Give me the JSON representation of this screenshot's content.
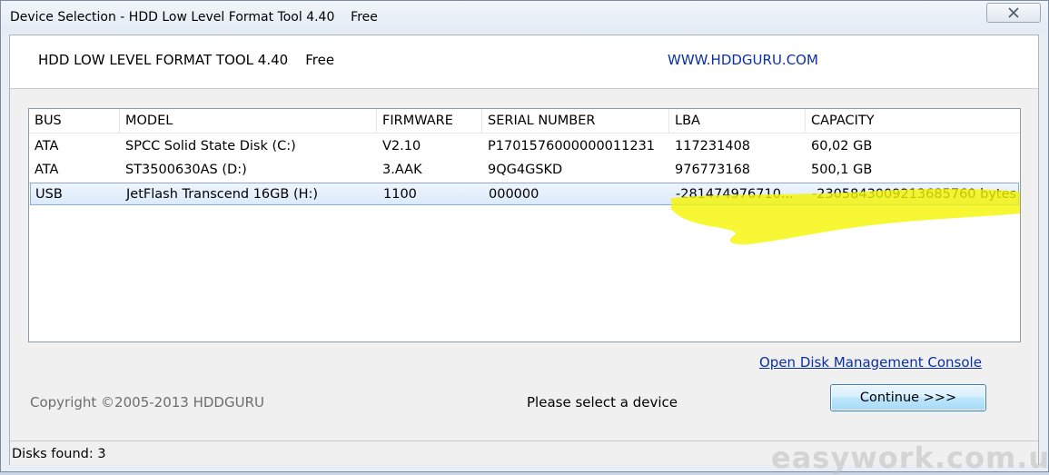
{
  "window": {
    "title": "Device Selection - HDD Low Level Format Tool 4.40    Free"
  },
  "header": {
    "product": "HDD LOW LEVEL FORMAT TOOL 4.40    Free",
    "website": "WWW.HDDGURU.COM"
  },
  "device_list": {
    "columns": [
      "BUS",
      "MODEL",
      "FIRMWARE",
      "SERIAL NUMBER",
      "LBA",
      "CAPACITY"
    ],
    "rows": [
      {
        "bus": "ATA",
        "model": "SPCC Solid State Disk (C:)",
        "firmware": "V2.10",
        "serial": "P1701576000000011231",
        "lba": "117231408",
        "capacity": "60,02 GB"
      },
      {
        "bus": "ATA",
        "model": "ST3500630AS (D:)",
        "firmware": "3.AAK",
        "serial": "9QG4GSKD",
        "lba": "976773168",
        "capacity": "500,1 GB"
      },
      {
        "bus": "USB",
        "model": "JetFlash Transcend 16GB (H:)",
        "firmware": "1100",
        "serial": "000000",
        "lba": "-281474976710...",
        "capacity": "-2305843009213685760 bytes"
      }
    ],
    "selected_index": 2
  },
  "actions": {
    "disk_management_link": "Open Disk Management Console",
    "continue_label": "Continue >>>"
  },
  "footer": {
    "copyright": "Copyright ©2005-2013 HDDGURU",
    "status_message": "Please select a device",
    "disks_found": "Disks found: 3"
  },
  "watermark": "easywork.com.ua",
  "colors": {
    "link": "#0b2fa8",
    "selection_border": "#84acdd",
    "highlight_marker": "#f5f500"
  },
  "icons": {
    "close": "close-icon"
  }
}
